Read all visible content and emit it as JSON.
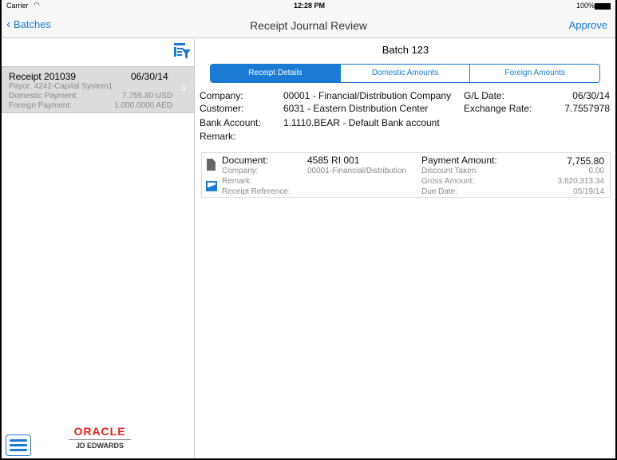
{
  "status": {
    "carrier": "Carrier",
    "time": "12:28 PM",
    "battery": "100%"
  },
  "nav": {
    "back": "Batches",
    "title": "Receipt Journal Review",
    "action": "Approve"
  },
  "list": [
    {
      "title": "Receipt 201039",
      "date": "06/30/14",
      "payor": "Payor: 4242-Capital System1",
      "dom_label": "Domestic Payment:",
      "dom_value": "7,755.80 USD",
      "for_label": "Foreign Payment:",
      "for_value": "1,000.0000 AED"
    }
  ],
  "logo": {
    "brand": "ORACLE",
    "product": "JD EDWARDS"
  },
  "detail": {
    "batch": "Batch 123",
    "tabs": [
      "Receipt Details",
      "Domestic Amounts",
      "Foreign Amounts"
    ],
    "company_label": "Company:",
    "company": "00001 - Financial/Distribution Company",
    "customer_label": "Customer:",
    "customer": "6031 - Eastern Distribution Center",
    "bank_label": "Bank Account:",
    "bank": "1.1110.BEAR - Default Bank account",
    "remark_label": "Remark:",
    "gl_label": "G/L Date:",
    "gl": "06/30/14",
    "rate_label": "Exchange Rate:",
    "rate": "7.7557978"
  },
  "document": {
    "doc_label": "Document:",
    "doc": "4585 RI 001",
    "company_label": "Company:",
    "company": "00001-Financial/Distribution",
    "remark_label": "Remark:",
    "ref_label": "Receipt Reference:",
    "pay_label": "Payment Amount:",
    "pay": "7,755.80",
    "disc_label": "Discount Taken:",
    "disc": "0.00",
    "gross_label": "Gross Amount:",
    "gross": "3,620,313.34",
    "due_label": "Due Date:",
    "due": "05/19/14"
  }
}
